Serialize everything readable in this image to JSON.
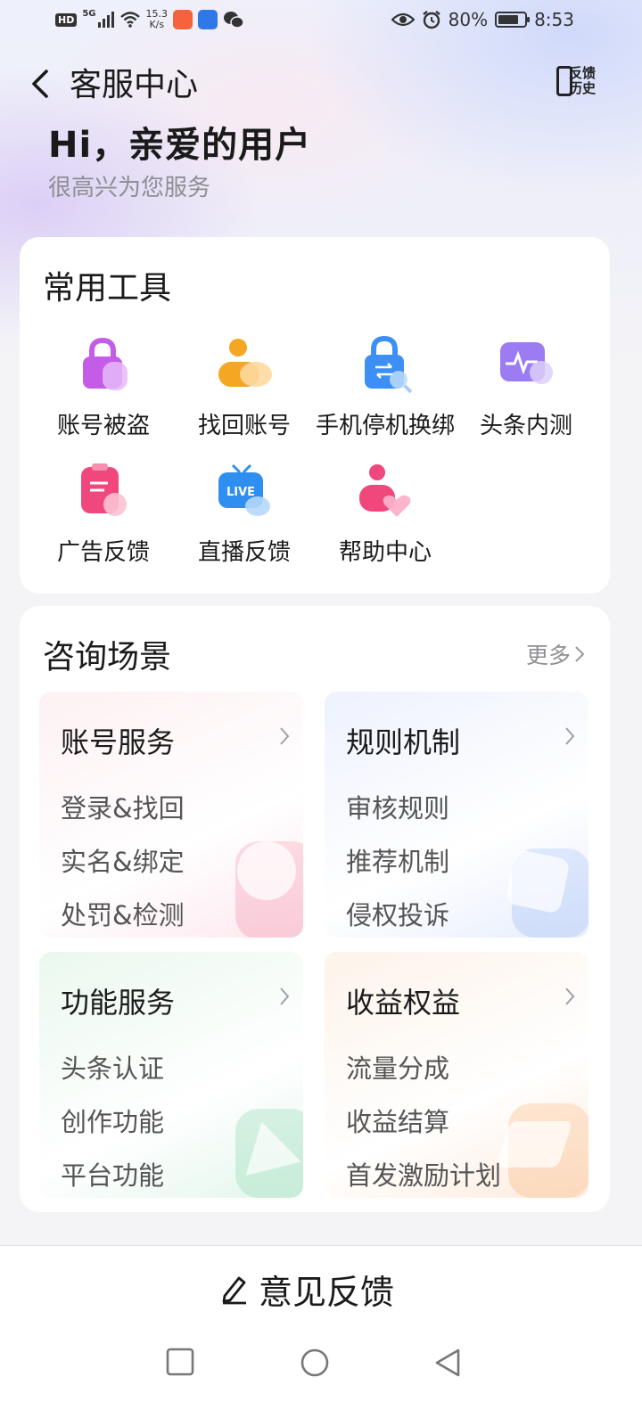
{
  "status_bar": {
    "network_badge": "HD",
    "network_type": "5G",
    "speed_value": "15.3",
    "speed_unit": "K/s",
    "battery": "80%",
    "battery_level": 0.8,
    "time": "8:53"
  },
  "header": {
    "title": "客服中心",
    "history_label_line1": "反馈",
    "history_label_line2": "历史"
  },
  "greeting": {
    "title": "Hi，亲爱的用户",
    "subtitle": "很高兴为您服务"
  },
  "tools": {
    "title": "常用工具",
    "items": [
      {
        "label": "账号被盗",
        "icon": "lock-icon",
        "color": "#c45ce8"
      },
      {
        "label": "找回账号",
        "icon": "user-search-icon",
        "color": "#f5a623"
      },
      {
        "label": "手机停机换绑",
        "icon": "lock-swap-icon",
        "color": "#3d8ff5"
      },
      {
        "label": "头条内测",
        "icon": "pulse-icon",
        "color": "#9b7cf2"
      },
      {
        "label": "广告反馈",
        "icon": "clipboard-icon",
        "color": "#f0477d"
      },
      {
        "label": "直播反馈",
        "icon": "live-tv-icon",
        "color": "#2f8ff0"
      },
      {
        "label": "帮助中心",
        "icon": "user-heart-icon",
        "color": "#f0477d"
      }
    ]
  },
  "consult": {
    "title": "咨询场景",
    "more_label": "更多",
    "tiles": [
      {
        "title": "账号服务",
        "items": [
          "登录&找回",
          "实名&绑定",
          "处罚&检测"
        ]
      },
      {
        "title": "规则机制",
        "items": [
          "审核规则",
          "推荐机制",
          "侵权投诉"
        ]
      },
      {
        "title": "功能服务",
        "items": [
          "头条认证",
          "创作功能",
          "平台功能"
        ]
      },
      {
        "title": "收益权益",
        "items": [
          "流量分成",
          "收益结算",
          "首发激励计划"
        ]
      }
    ]
  },
  "bottom": {
    "feedback_label": "意见反馈"
  }
}
